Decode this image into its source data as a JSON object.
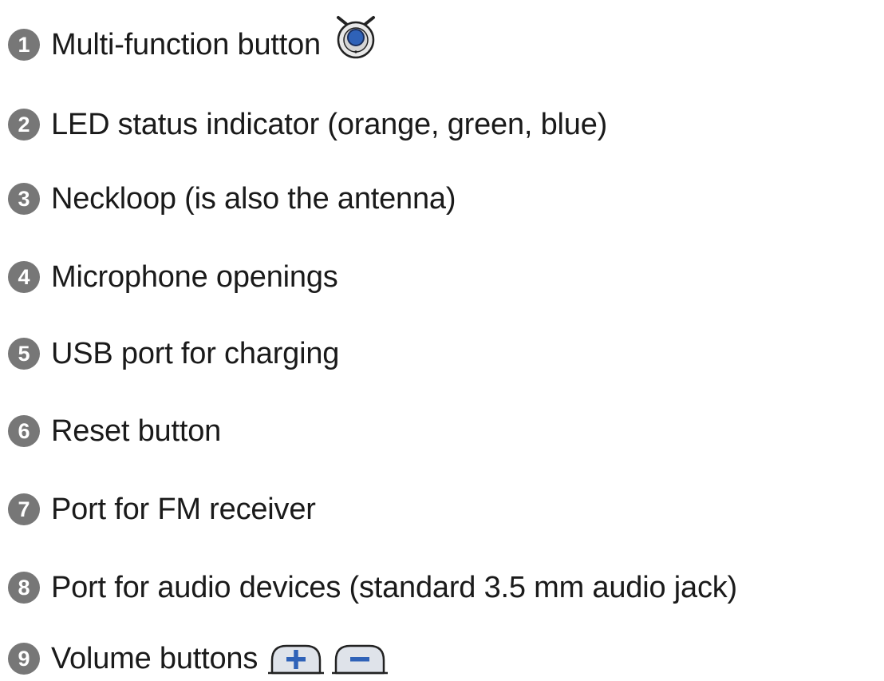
{
  "legend": {
    "items": [
      {
        "number": "1",
        "label": "Multi-function button",
        "icon": "multi-function-button-icon"
      },
      {
        "number": "2",
        "label": "LED status indicator (orange, green, blue)"
      },
      {
        "number": "3",
        "label": "Neckloop (is also the antenna)"
      },
      {
        "number": "4",
        "label": "Microphone openings"
      },
      {
        "number": "5",
        "label": "USB port for charging"
      },
      {
        "number": "6",
        "label": "Reset button"
      },
      {
        "number": "7",
        "label": "Port for FM receiver"
      },
      {
        "number": "8",
        "label": "Port for audio devices (standard 3.5 mm audio jack)"
      },
      {
        "number": "9",
        "label": "Volume buttons",
        "icons": [
          "volume-up-icon",
          "volume-down-icon"
        ]
      }
    ]
  },
  "colors": {
    "badge": "#777777",
    "text": "#1a1a1a",
    "icon_blue": "#2f62b8",
    "button_face": "#dfe3ea"
  }
}
